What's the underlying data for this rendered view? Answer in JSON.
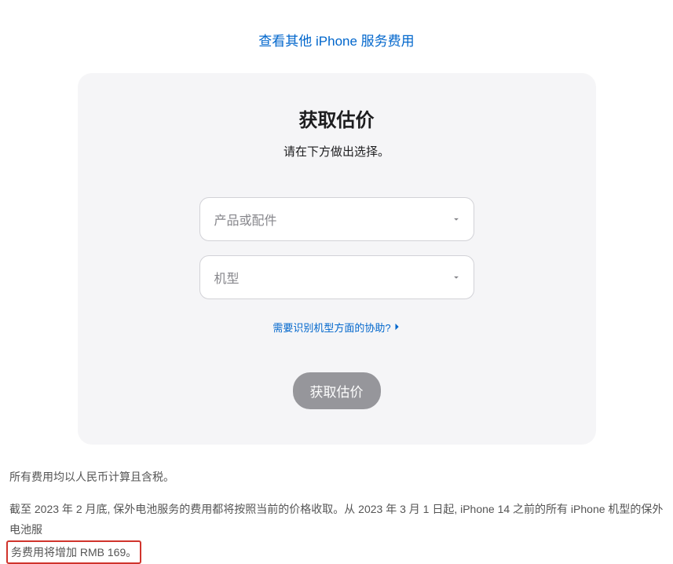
{
  "topLink": {
    "label": "查看其他 iPhone 服务费用"
  },
  "card": {
    "title": "获取估价",
    "subtitle": "请在下方做出选择。",
    "select1": {
      "placeholder": "产品或配件"
    },
    "select2": {
      "placeholder": "机型"
    },
    "helpLink": "需要识别机型方面的协助?",
    "submitButton": "获取估价"
  },
  "footer": {
    "line1": "所有费用均以人民币计算且含税。",
    "line2_part1": "截至 2023 年 2 月底, 保外电池服务的费用都将按照当前的价格收取。从 2023 年 3 月 1 日起, iPhone 14 之前的所有 iPhone 机型的保外电池服",
    "line2_part2": "务费用将增加 RMB 169。"
  }
}
